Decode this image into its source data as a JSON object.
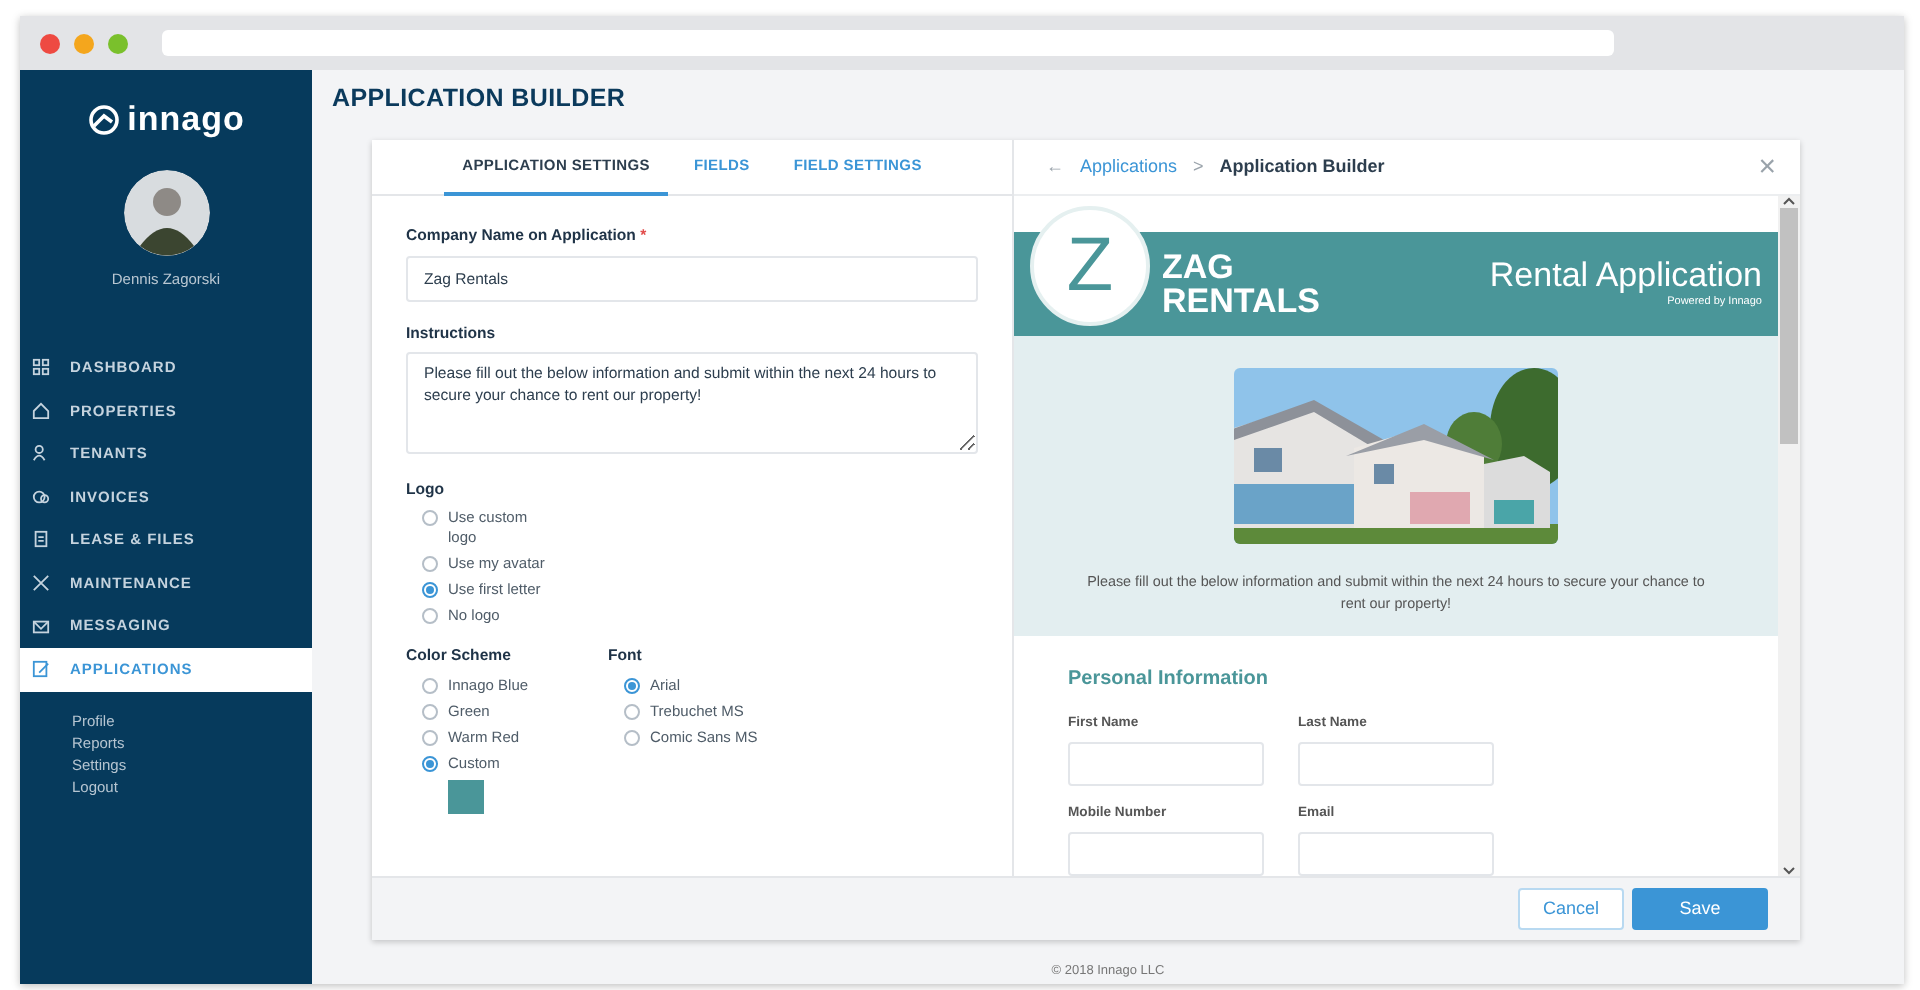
{
  "sidebar": {
    "logo_text": "innago",
    "user_name": "Dennis Zagorski",
    "nav": [
      {
        "label": "DASHBOARD",
        "selected": false
      },
      {
        "label": "PROPERTIES",
        "selected": false
      },
      {
        "label": "TENANTS",
        "selected": false
      },
      {
        "label": "INVOICES",
        "selected": false
      },
      {
        "label": "LEASE & FILES",
        "selected": false
      },
      {
        "label": "MAINTENANCE",
        "selected": false
      },
      {
        "label": "MESSAGING",
        "selected": false
      },
      {
        "label": "APPLICATIONS",
        "selected": true
      }
    ],
    "sub_links": [
      "Profile",
      "Reports",
      "Settings",
      "Logout"
    ]
  },
  "page_title": "APPLICATION BUILDER",
  "tabs": [
    {
      "label": "APPLICATION SETTINGS",
      "selected": true
    },
    {
      "label": "FIELDS",
      "selected": false
    },
    {
      "label": "FIELD SETTINGS",
      "selected": false
    }
  ],
  "form": {
    "company_label": "Company Name on Application",
    "required_mark": "*",
    "company_value": "Zag Rentals",
    "instructions_label": "Instructions",
    "instructions_value": "Please fill out the below information and submit within the next 24 hours to secure your chance to rent our property!",
    "logo": {
      "label": "Logo",
      "options": [
        {
          "label": "Use custom logo",
          "selected": false
        },
        {
          "label": "Use my avatar",
          "selected": false
        },
        {
          "label": "Use first letter",
          "selected": true
        },
        {
          "label": "No logo",
          "selected": false
        }
      ]
    },
    "color_scheme": {
      "label": "Color Scheme",
      "options": [
        {
          "label": "Innago Blue",
          "selected": false
        },
        {
          "label": "Green",
          "selected": false
        },
        {
          "label": "Warm Red",
          "selected": false
        },
        {
          "label": "Custom",
          "selected": true,
          "color": "#4a9699"
        }
      ]
    },
    "font": {
      "label": "Font",
      "options": [
        {
          "label": "Arial",
          "selected": true
        },
        {
          "label": "Trebuchet MS",
          "selected": false
        },
        {
          "label": "Comic Sans MS",
          "selected": false
        }
      ]
    }
  },
  "preview": {
    "breadcrumb": {
      "back": "←",
      "parent": "Applications",
      "separator": ">",
      "current": "Application Builder"
    },
    "close": "×",
    "letter": "Z",
    "company_lines": [
      "ZAG",
      "RENTALS"
    ],
    "title": "Rental Application",
    "powered_by": "Powered by Innago",
    "instructions": "Please fill out the below information and submit within the next 24 hours to secure your chance to rent our property!",
    "section_title": "Personal Information",
    "fields": [
      {
        "label": "First Name"
      },
      {
        "label": "Last Name"
      },
      {
        "label": "Mobile Number"
      },
      {
        "label": "Email"
      }
    ]
  },
  "buttons": {
    "cancel": "Cancel",
    "save": "Save"
  },
  "copyright": "© 2018 Innago LLC"
}
